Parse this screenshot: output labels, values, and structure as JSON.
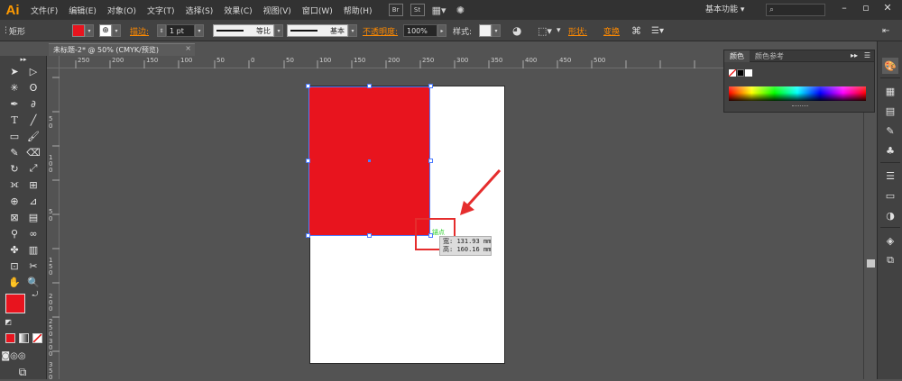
{
  "app": {
    "logo": "Ai",
    "menu": [
      "文件(F)",
      "编辑(E)",
      "对象(O)",
      "文字(T)",
      "选择(S)",
      "效果(C)",
      "视图(V)",
      "窗口(W)",
      "帮助(H)"
    ],
    "workspace": "基本功能",
    "toolbar_icons": [
      "bridge-icon",
      "stock-icon",
      "arrange-documents-icon",
      "gpu-icon"
    ]
  },
  "control_bar": {
    "object_label": "矩形",
    "fill_color": "#e8141e",
    "stroke_label": "描边:",
    "stroke_weight": "1 pt",
    "profile_label": "等比",
    "brush_label": "基本",
    "opacity_label": "不透明度:",
    "opacity_value": "100%",
    "style_label": "样式:",
    "shape_label": "形状:",
    "transform_label": "变换"
  },
  "document": {
    "tab_title": "未标题-2* @ 50% (CMYK/预览)",
    "close_glyph": "×"
  },
  "rulers": {
    "h_labels": [
      "250",
      "200",
      "150",
      "100",
      "50",
      "0",
      "50",
      "100",
      "150",
      "200",
      "250",
      "300",
      "350",
      "400",
      "450",
      "500"
    ],
    "v_labels": [
      "5",
      "0",
      "5",
      "0",
      "1 0 0",
      "1 5 0",
      "2 0 0",
      "2 5 0",
      "3 0 0",
      "3 5 0"
    ]
  },
  "selection": {
    "fill": "#e8141e",
    "handle_color": "#4d7cff",
    "anchor_label": "锚点",
    "width_label": "宽",
    "width_value": "131.93 mm",
    "height_label": "高",
    "height_value": "160.16 mm"
  },
  "annotation": {
    "highlight_color": "#e52d2d"
  },
  "color_panel": {
    "tab_color": "颜色",
    "tab_guide": "颜色参考"
  },
  "tools": {
    "fill_swatch": "#e8141e",
    "stroke_swatch": "#000000"
  }
}
